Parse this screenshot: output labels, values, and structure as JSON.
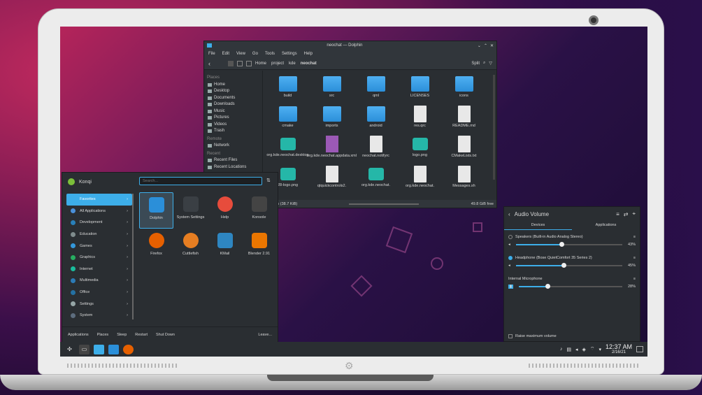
{
  "dolphin": {
    "title": "neochat — Dolphin",
    "menu": [
      "File",
      "Edit",
      "View",
      "Go",
      "Tools",
      "Settings",
      "Help"
    ],
    "breadcrumb": [
      "Home",
      "project",
      "kde",
      "neochat"
    ],
    "split_label": "Split",
    "places": {
      "header": "Places",
      "items": [
        "Home",
        "Desktop",
        "Documents",
        "Downloads",
        "Music",
        "Pictures",
        "Videos",
        "Trash"
      ],
      "remote_header": "Remote",
      "remote_items": [
        "Network"
      ],
      "recent_header": "Recent",
      "recent_items": [
        "Recent Files",
        "Recent Locations"
      ]
    },
    "files": [
      {
        "name": "build",
        "kind": "folder"
      },
      {
        "name": "src",
        "kind": "folder"
      },
      {
        "name": "qml",
        "kind": "folder"
      },
      {
        "name": "LICENSES",
        "kind": "folder"
      },
      {
        "name": "icons",
        "kind": "folder"
      },
      {
        "name": "cmake",
        "kind": "folder"
      },
      {
        "name": "imports",
        "kind": "folder"
      },
      {
        "name": "android",
        "kind": "folder"
      },
      {
        "name": "res.qrc",
        "kind": "doc"
      },
      {
        "name": "README.md",
        "kind": "doc"
      },
      {
        "name": "org.kde.neochat.desktop",
        "kind": "teal"
      },
      {
        "name": "org.kde.neochat.appdata.xml",
        "kind": "purple"
      },
      {
        "name": "neochat.notifyrc",
        "kind": "doc"
      },
      {
        "name": "logo.png",
        "kind": "teal"
      },
      {
        "name": "CMakeLists.txt",
        "kind": "doc"
      },
      {
        "name": "28-logo.png",
        "kind": "teal"
      },
      {
        "name": "qtquickcontrols2.",
        "kind": "doc"
      },
      {
        "name": "org.kde.neochat.",
        "kind": "teal"
      },
      {
        "name": "org.kde.neochat.",
        "kind": "doc"
      },
      {
        "name": "Messages.sh",
        "kind": "doc"
      }
    ],
    "status_left": "",
    "status_files": "12 Files (38.7 KiB)",
    "status_free": "49.8 GiB free"
  },
  "launcher": {
    "user": "Konqi",
    "search_placeholder": "Search...",
    "categories": [
      "Favorites",
      "All Applications",
      "Development",
      "Education",
      "Games",
      "Graphics",
      "Internet",
      "Multimedia",
      "Office",
      "Settings",
      "System"
    ],
    "apps": [
      "Dolphin",
      "System Settings",
      "Help",
      "Konsole",
      "Firefox",
      "Cuttlefish",
      "KMail",
      "Blender 2.91"
    ],
    "footer": {
      "applications": "Applications",
      "places": "Places",
      "sleep": "Sleep",
      "restart": "Restart",
      "shutdown": "Shut Down",
      "leave": "Leave..."
    }
  },
  "audio": {
    "title": "Audio Volume",
    "tabs": [
      "Devices",
      "Applications"
    ],
    "devices": [
      {
        "name": "Speakers (Built-in Audio Analog Stereo)",
        "percent": "43%",
        "level": 0.43
      },
      {
        "name": "Headphone (Bose QuietComfort 35 Series 2)",
        "percent": "45%",
        "level": 0.45
      }
    ],
    "mic": {
      "name": "Internal Microphone",
      "percent": "28%",
      "level": 0.28
    },
    "raise_max": "Raise maximum volume"
  },
  "clock": {
    "time": "12:37 AM",
    "date": "2/16/21"
  }
}
